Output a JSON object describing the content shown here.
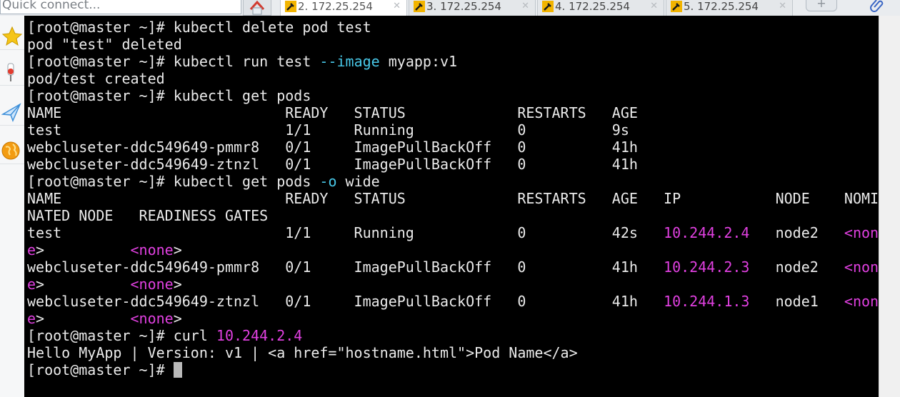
{
  "quick_connect": {
    "placeholder": "Quick connect..."
  },
  "tabs": [
    {
      "label": "2. 172.25.254",
      "active": true
    },
    {
      "label": "3. 172.25.254",
      "active": false
    },
    {
      "label": "4. 172.25.254",
      "active": false
    },
    {
      "label": "5. 172.25.254",
      "active": false
    }
  ],
  "tab_close_glyph": "✕",
  "new_tab_glyph": "+",
  "icons": {
    "home": "home-icon",
    "tab": "session-key-icon",
    "attach": "paperclip-icon",
    "side": [
      "star-icon",
      "pin-icon",
      "send-icon",
      "globe-icon"
    ]
  },
  "colors": {
    "terminal_bg": "#000000",
    "terminal_fg": "#eaeaea",
    "option_color": "#48c8e8",
    "ip_color": "#e040e0"
  },
  "terminal": {
    "lines": [
      [
        {
          "t": "[root@master ~]# kubectl delete pod test"
        }
      ],
      [
        {
          "t": "pod \"test\" deleted"
        }
      ],
      [
        {
          "t": "[root@master ~]# kubectl run test "
        },
        {
          "t": "--image",
          "c": "cyan"
        },
        {
          "t": " myapp:v1"
        }
      ],
      [
        {
          "t": "pod/test created"
        }
      ],
      [
        {
          "t": "[root@master ~]# kubectl get pods"
        }
      ],
      [
        {
          "t": "NAME                          READY   STATUS             RESTARTS   AGE"
        }
      ],
      [
        {
          "t": "test                          1/1     Running            0          9s"
        }
      ],
      [
        {
          "t": "webcluseter-ddc549649-pmmr8   0/1     ImagePullBackOff   0          41h"
        }
      ],
      [
        {
          "t": "webcluseter-ddc549649-ztnzl   0/1     ImagePullBackOff   0          41h"
        }
      ],
      [
        {
          "t": "[root@master ~]# kubectl get pods "
        },
        {
          "t": "-o",
          "c": "cyan"
        },
        {
          "t": " wide"
        }
      ],
      [
        {
          "t": "NAME                          READY   STATUS             RESTARTS   AGE   IP           NODE    NOMI"
        }
      ],
      [
        {
          "t": "NATED NODE   READINESS GATES"
        }
      ],
      [
        {
          "t": "test                          1/1     Running            0          42s   "
        },
        {
          "t": "10.244.2.4",
          "c": "magenta"
        },
        {
          "t": "   node2   "
        },
        {
          "t": "<non",
          "c": "magenta"
        }
      ],
      [
        {
          "t": "e",
          "c": "magenta"
        },
        {
          "t": ">          "
        },
        {
          "t": "<none",
          "c": "magenta"
        },
        {
          "t": ">"
        }
      ],
      [
        {
          "t": "webcluseter-ddc549649-pmmr8   0/1     ImagePullBackOff   0          41h   "
        },
        {
          "t": "10.244.2.3",
          "c": "magenta"
        },
        {
          "t": "   node2   "
        },
        {
          "t": "<non",
          "c": "magenta"
        }
      ],
      [
        {
          "t": "e",
          "c": "magenta"
        },
        {
          "t": ">          "
        },
        {
          "t": "<none",
          "c": "magenta"
        },
        {
          "t": ">"
        }
      ],
      [
        {
          "t": "webcluseter-ddc549649-ztnzl   0/1     ImagePullBackOff   0          41h   "
        },
        {
          "t": "10.244.1.3",
          "c": "magenta"
        },
        {
          "t": "   node1   "
        },
        {
          "t": "<non",
          "c": "magenta"
        }
      ],
      [
        {
          "t": "e",
          "c": "magenta"
        },
        {
          "t": ">          "
        },
        {
          "t": "<none",
          "c": "magenta"
        },
        {
          "t": ">"
        }
      ],
      [
        {
          "t": "[root@master ~]# curl "
        },
        {
          "t": "10.244.2.4",
          "c": "magenta"
        }
      ],
      [
        {
          "t": "Hello MyApp | Version: v1 | <a href=\"hostname.html\">Pod Name</a>"
        }
      ],
      [
        {
          "t": "[root@master ~]# "
        },
        {
          "cursor": true
        }
      ]
    ]
  }
}
